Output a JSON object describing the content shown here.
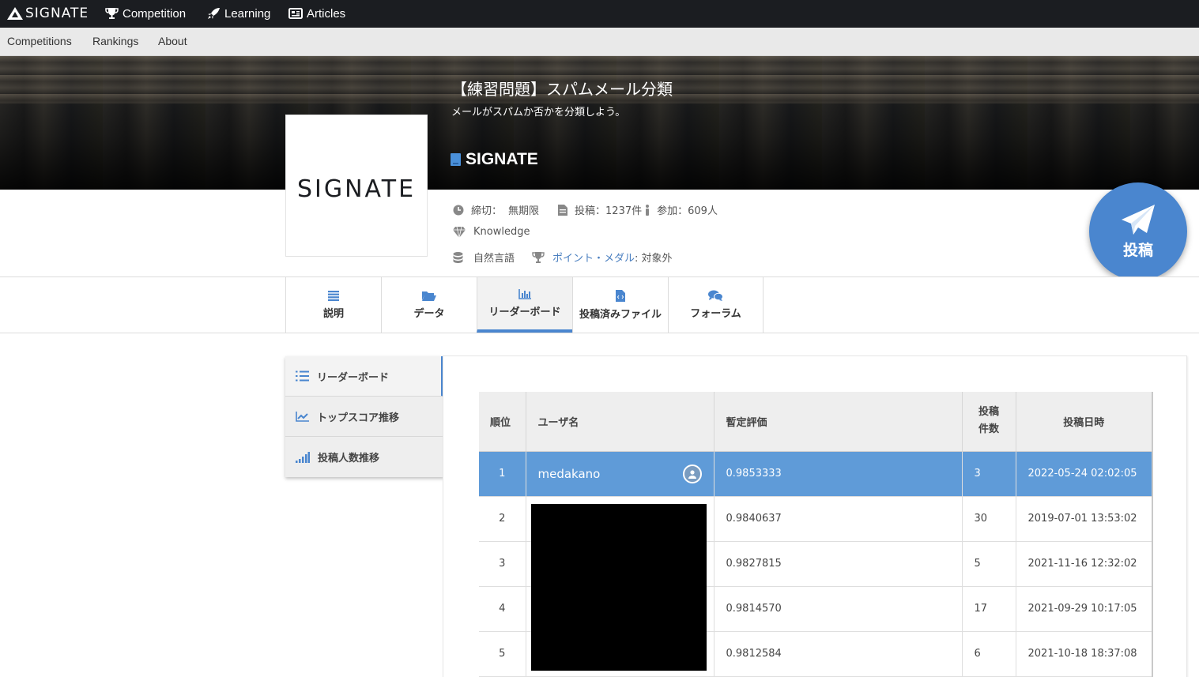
{
  "topnav": {
    "logo_text": "SIGNATE",
    "items": [
      {
        "label": "Competition",
        "icon": "trophy-icon"
      },
      {
        "label": "Learning",
        "icon": "rocket-icon"
      },
      {
        "label": "Articles",
        "icon": "newspaper-icon"
      }
    ]
  },
  "subnav": {
    "items": [
      "Competitions",
      "Rankings",
      "About"
    ]
  },
  "competition": {
    "title": "【練習問題】スパムメール分類",
    "subtitle": "メールがスパムか否かを分類しよう。",
    "organizer": "SIGNATE",
    "logo_text": "SIGNATE",
    "deadline_label": "締切：",
    "deadline_value": "無期限",
    "submissions": "投稿：1237件",
    "participants": "参加：609人",
    "type": "Knowledge",
    "category": "自然言語",
    "points_link": "ポイント・メダル",
    "points_suffix": ": 対象外"
  },
  "submit_button": {
    "label": "投稿",
    "icon": "paper-plane-icon"
  },
  "tabs": [
    {
      "label": "説明",
      "icon": "list-icon"
    },
    {
      "label": "データ",
      "icon": "folder-open-icon"
    },
    {
      "label": "リーダーボード",
      "icon": "bar-chart-icon",
      "active": true
    },
    {
      "label": "投稿済みファイル",
      "icon": "file-code-icon"
    },
    {
      "label": "フォーラム",
      "icon": "comments-icon"
    }
  ],
  "sidemenu": [
    {
      "label": "リーダーボード",
      "icon": "list-ol-icon",
      "active": true
    },
    {
      "label": "トップスコア推移",
      "icon": "line-chart-icon"
    },
    {
      "label": "投稿人数推移",
      "icon": "signal-icon"
    }
  ],
  "leaderboard": {
    "headers": {
      "rank": "順位",
      "user": "ユーザ名",
      "score": "暫定評価",
      "count_line1": "投稿",
      "count_line2": "件数",
      "date": "投稿日時"
    },
    "rows": [
      {
        "rank": "1",
        "user": "medakano",
        "score": "0.9853333",
        "count": "3",
        "date": "2022-05-24 02:02:05"
      },
      {
        "rank": "2",
        "user": "",
        "score": "0.9840637",
        "count": "30",
        "date": "2019-07-01 13:53:02"
      },
      {
        "rank": "3",
        "user": "",
        "score": "0.9827815",
        "count": "5",
        "date": "2021-11-16 12:32:02"
      },
      {
        "rank": "4",
        "user": "",
        "score": "0.9814570",
        "count": "17",
        "date": "2021-09-29 10:17:05"
      },
      {
        "rank": "5",
        "user": "",
        "score": "0.9812584",
        "count": "6",
        "date": "2021-10-18 18:37:08"
      }
    ]
  },
  "colors": {
    "topnav_bg": "#1b1d21",
    "accent": "#4a86cf",
    "highlight_row": "#5f9bd8"
  }
}
